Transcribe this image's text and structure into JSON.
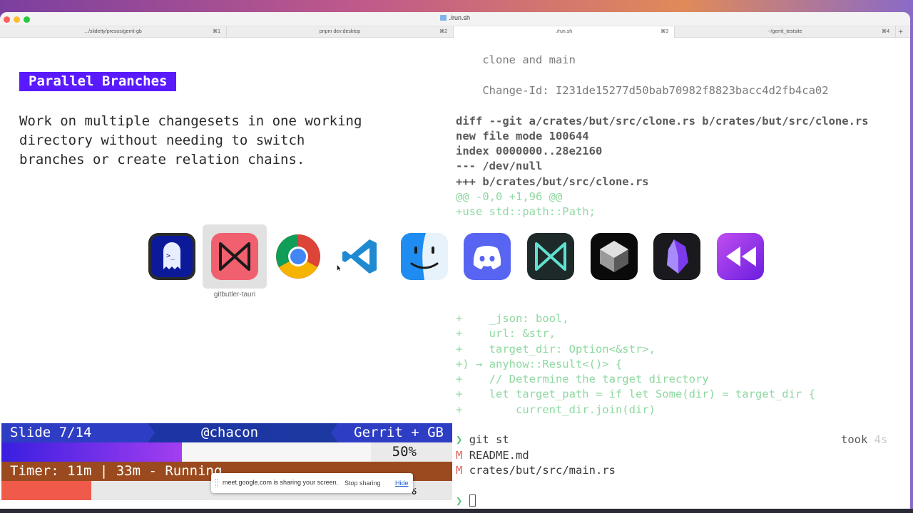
{
  "window": {
    "title": "./run.sh"
  },
  "tabs": [
    {
      "label": ".../slidetty/presos/gerrit-gb",
      "key": "⌘1"
    },
    {
      "label": "pnpm dev:desktop",
      "key": "⌘2"
    },
    {
      "label": "./run.sh",
      "key": "⌘3"
    },
    {
      "label": "~/gerrit_testsite",
      "key": "⌘4"
    }
  ],
  "tab_add": "+",
  "slide": {
    "title": "Parallel Branches",
    "body": "Work on multiple changesets in one working\ndirectory without needing to switch\nbranches or create relation chains."
  },
  "status": {
    "slide": "Slide 7/14",
    "author": "@chacon",
    "topic": "Gerrit + GB",
    "progress_percent": 50,
    "progress_label": "50%",
    "timer": "Timer: 11m | 33m - Running",
    "timer_fraction": 0.2,
    "timer_pct_label": "%"
  },
  "terminal": {
    "commit_msg": "    clone and main",
    "change_id": "    Change-Id: I231de15277d50bab70982f8823bacc4d2fb4ca02",
    "diff_header": "diff --git a/crates/but/src/clone.rs b/crates/but/src/clone.rs",
    "new_file": "new file mode 100644",
    "index": "index 0000000..28e2160",
    "minus": "--- /dev/null",
    "plus": "+++ b/crates/but/src/clone.rs",
    "hunk": "@@ -0,0 +1,96 @@",
    "use_line": "+use std::path::Path;",
    "code": [
      "+    _json: bool,",
      "+    url: &str,",
      "+    target_dir: Option<&str>,",
      "+) → anyhow::Result<()> {",
      "+    // Determine the target directory",
      "+    let target_path = if let Some(dir) = target_dir {",
      "+        current_dir.join(dir)"
    ],
    "prompt_symbol": "❯",
    "command": "git st",
    "took_label": "took",
    "took_value": "4s",
    "modified_marker": "M",
    "modified_files": [
      "README.md",
      "crates/but/src/main.rs"
    ]
  },
  "dock": {
    "apps": [
      {
        "icon": "ghostty-icon"
      },
      {
        "icon": "gitbutler-tauri-icon",
        "tooltip": "gitbutler-tauri"
      },
      {
        "icon": "chrome-icon"
      },
      {
        "icon": "vscode-icon"
      },
      {
        "icon": "finder-icon"
      },
      {
        "icon": "discord-icon"
      },
      {
        "icon": "gitbutler-icon"
      },
      {
        "icon": "cube-app-icon"
      },
      {
        "icon": "obsidian-icon"
      },
      {
        "icon": "rewind-icon"
      }
    ],
    "hover_tooltip": "gitbutler-tauri"
  },
  "share": {
    "message": "meet.google.com is sharing your screen.",
    "stop": "Stop sharing",
    "hide": "Hide"
  },
  "colors": {
    "slide_title_bg": "#5a1aff",
    "status_bar": "#1f2fa8",
    "timer_bar": "#9a4a1e",
    "timer_fill": "#f05a4a",
    "diff_green": "#8ed8a0"
  }
}
